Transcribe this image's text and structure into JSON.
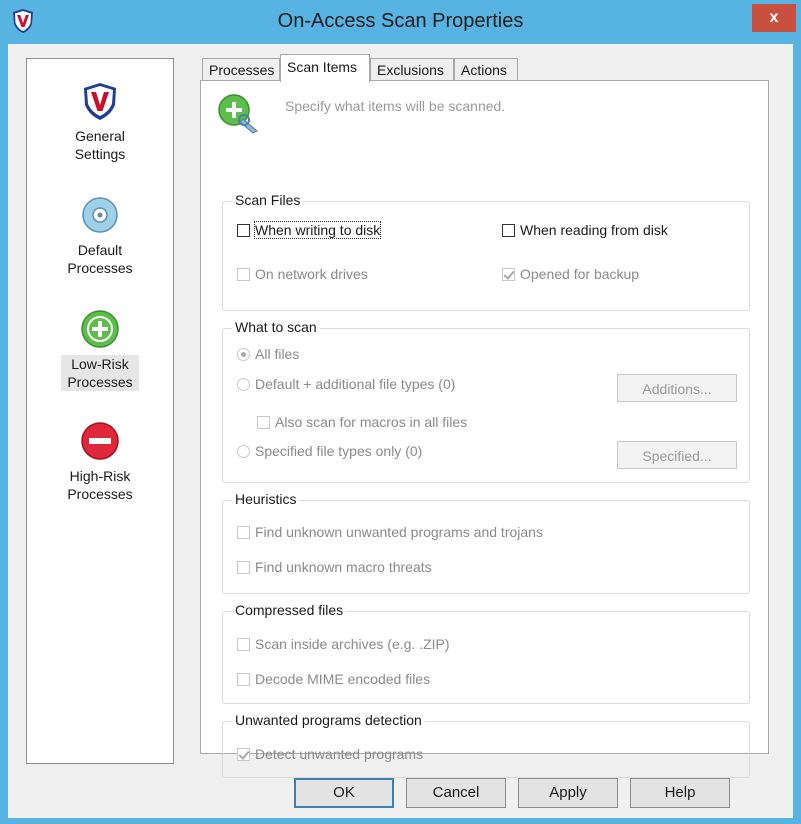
{
  "window": {
    "title": "On-Access Scan Properties",
    "close_glyph": "x"
  },
  "sidebar": {
    "items": [
      {
        "label": "General Settings",
        "icon": "mcafee-shield-icon"
      },
      {
        "label": "Default Processes",
        "icon": "disc-icon"
      },
      {
        "label": "Low-Risk Processes",
        "icon": "green-plus-icon",
        "selected": true
      },
      {
        "label": "High-Risk Processes",
        "icon": "red-minus-icon"
      }
    ]
  },
  "tabs": [
    {
      "label": "Processes"
    },
    {
      "label": "Scan Items",
      "active": true
    },
    {
      "label": "Exclusions"
    },
    {
      "label": "Actions"
    }
  ],
  "panel": {
    "description": "Specify what items will be scanned.",
    "scan_files": {
      "title": "Scan Files",
      "when_writing": {
        "label": "When writing to disk",
        "checked": false
      },
      "when_reading": {
        "label": "When reading from disk",
        "checked": false
      },
      "network_drives": {
        "label": "On network drives",
        "checked": false
      },
      "opened_backup": {
        "label": "Opened for backup",
        "checked": true
      }
    },
    "what_to_scan": {
      "title": "What to scan",
      "all_files": {
        "label": "All files",
        "selected": true
      },
      "default_additional": {
        "label": "Default + additional file types (0)",
        "selected": false
      },
      "additions_button": "Additions...",
      "macros": {
        "label": "Also scan for macros in all files",
        "checked": false
      },
      "specified_only": {
        "label": "Specified file types only (0)",
        "selected": false
      },
      "specified_button": "Specified..."
    },
    "heuristics": {
      "title": "Heuristics",
      "unwanted_trojans": {
        "label": "Find unknown unwanted programs and trojans",
        "checked": false
      },
      "macro_threats": {
        "label": "Find unknown macro threats",
        "checked": false
      }
    },
    "compressed": {
      "title": "Compressed files",
      "archives": {
        "label": "Scan inside archives (e.g. .ZIP)",
        "checked": false
      },
      "mime": {
        "label": "Decode MIME encoded files",
        "checked": false
      }
    },
    "unwanted": {
      "title": "Unwanted programs detection",
      "detect": {
        "label": "Detect unwanted programs",
        "checked": true
      }
    }
  },
  "footer": {
    "ok": "OK",
    "cancel": "Cancel",
    "apply": "Apply",
    "help": "Help"
  },
  "colors": {
    "title_bar": "#56b3e2",
    "close": "#c7503f",
    "dialog": "#f0f0f0"
  }
}
